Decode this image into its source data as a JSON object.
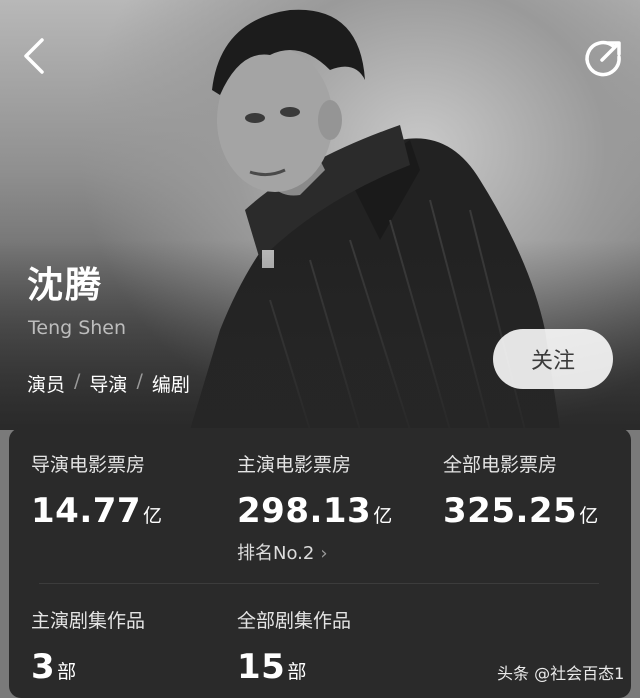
{
  "icons": {
    "back": "chevron-left-icon",
    "share": "share-icon"
  },
  "profile": {
    "name": "沈腾",
    "name_en": "Teng Shen",
    "roles": [
      "演员",
      "导演",
      "编剧"
    ],
    "role_separator": "/",
    "follow_label": "关注"
  },
  "stats": {
    "director_box": {
      "label": "导演电影票房",
      "value": "14.77",
      "unit": "亿"
    },
    "lead_box": {
      "label": "主演电影票房",
      "value": "298.13",
      "unit": "亿",
      "rank": "排名No.2",
      "rank_chevron": "›"
    },
    "all_box": {
      "label": "全部电影票房",
      "value": "325.25",
      "unit": "亿"
    },
    "lead_series": {
      "label": "主演剧集作品",
      "value": "3",
      "unit": "部"
    },
    "all_series": {
      "label": "全部剧集作品",
      "value": "15",
      "unit": "部"
    }
  },
  "watermark": "头条 @社会百态1",
  "colors": {
    "card_bg": "#2a2a2a",
    "follow_bg": "#e6e6e6",
    "text": "#ffffff"
  }
}
